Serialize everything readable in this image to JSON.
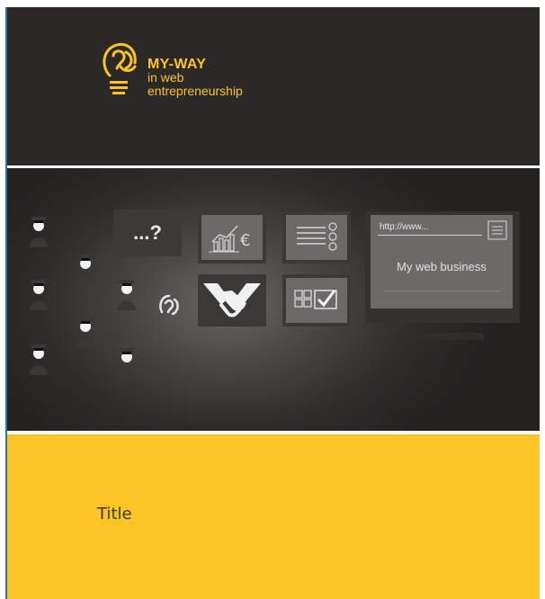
{
  "brand": {
    "line1": "MY-WAY",
    "line2": "in web",
    "line3": "entrepreneurship",
    "color": "#ffc423"
  },
  "banner": {
    "question": "...?",
    "url": "http://www...",
    "business_label": "My web business"
  },
  "footer": {
    "title": "Title",
    "color": "#fcc425"
  },
  "icons": [
    "bulb-logo-icon",
    "graduate-icon",
    "chart-euro-icon",
    "checklist-icon",
    "handshake-icon",
    "checkbox-grid-icon",
    "menu-icon",
    "monitor-icon"
  ]
}
